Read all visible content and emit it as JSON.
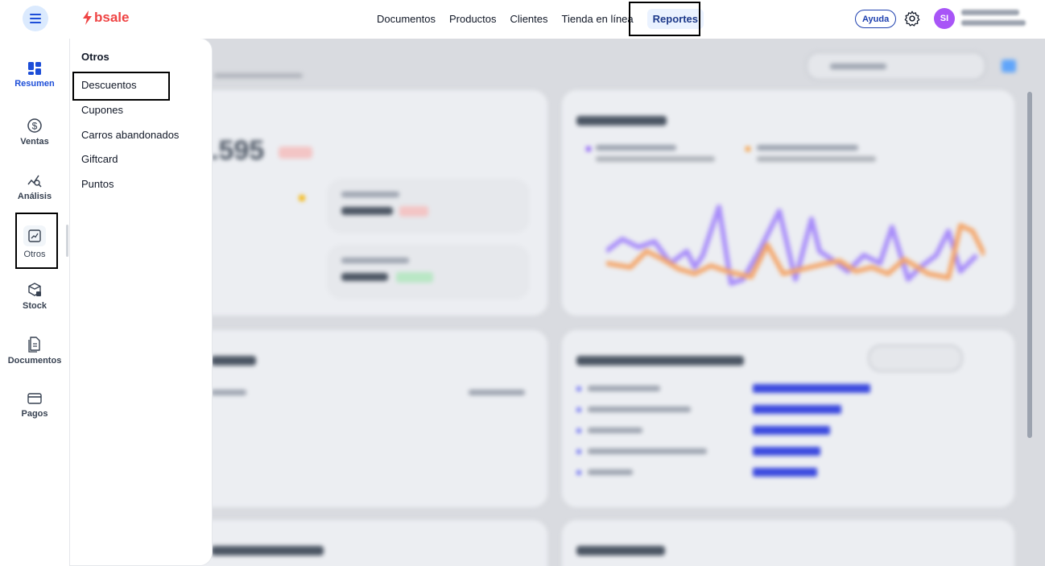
{
  "header": {
    "brand": "bsale",
    "nav": [
      "Documentos",
      "Productos",
      "Clientes",
      "Tienda en línea",
      "Reportes"
    ],
    "active_nav": "Reportes",
    "help_label": "Ayuda",
    "user_initials": "SI"
  },
  "sidebar": {
    "items": [
      {
        "label": "Resumen",
        "icon": "dashboard-icon"
      },
      {
        "label": "Ventas",
        "icon": "dollar-icon"
      },
      {
        "label": "Análisis",
        "icon": "analytics-icon"
      },
      {
        "label": "Otros",
        "icon": "chart-icon"
      },
      {
        "label": "Stock",
        "icon": "box-icon"
      },
      {
        "label": "Documentos",
        "icon": "document-icon"
      },
      {
        "label": "Pagos",
        "icon": "card-icon"
      }
    ],
    "active": "Resumen"
  },
  "dropdown": {
    "title": "Otros",
    "options": [
      "Descuentos",
      "Cupones",
      "Carros abandonados",
      "Giftcard",
      "Puntos"
    ]
  },
  "dashboard": {
    "big_value": ".595"
  },
  "colors": {
    "accent": "#1d4ed8",
    "brand": "#ef4444",
    "avatar": "#a855f7",
    "series_purple": "#a78bfa",
    "series_orange": "#f4a66a",
    "bars": "#3b49df"
  }
}
